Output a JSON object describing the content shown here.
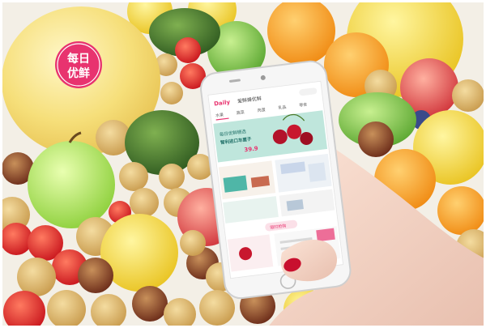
{
  "photo": {
    "sticker_text": [
      "每日",
      "优鲜"
    ],
    "app": {
      "brand": "Daily",
      "header_title": "爱鲜蜂优鲜",
      "tabs": [
        "水果",
        "蔬菜",
        "肉蛋",
        "乳品",
        "零食"
      ],
      "banner_line1": "每日优鲜精选",
      "banner_line2": "智利进口车厘子",
      "banner_price": "39.9",
      "section_label": "限时抢购"
    },
    "colors": {
      "brand": "#e8336f",
      "banner": "#bfe6dc",
      "nail": "#c8102e"
    }
  }
}
